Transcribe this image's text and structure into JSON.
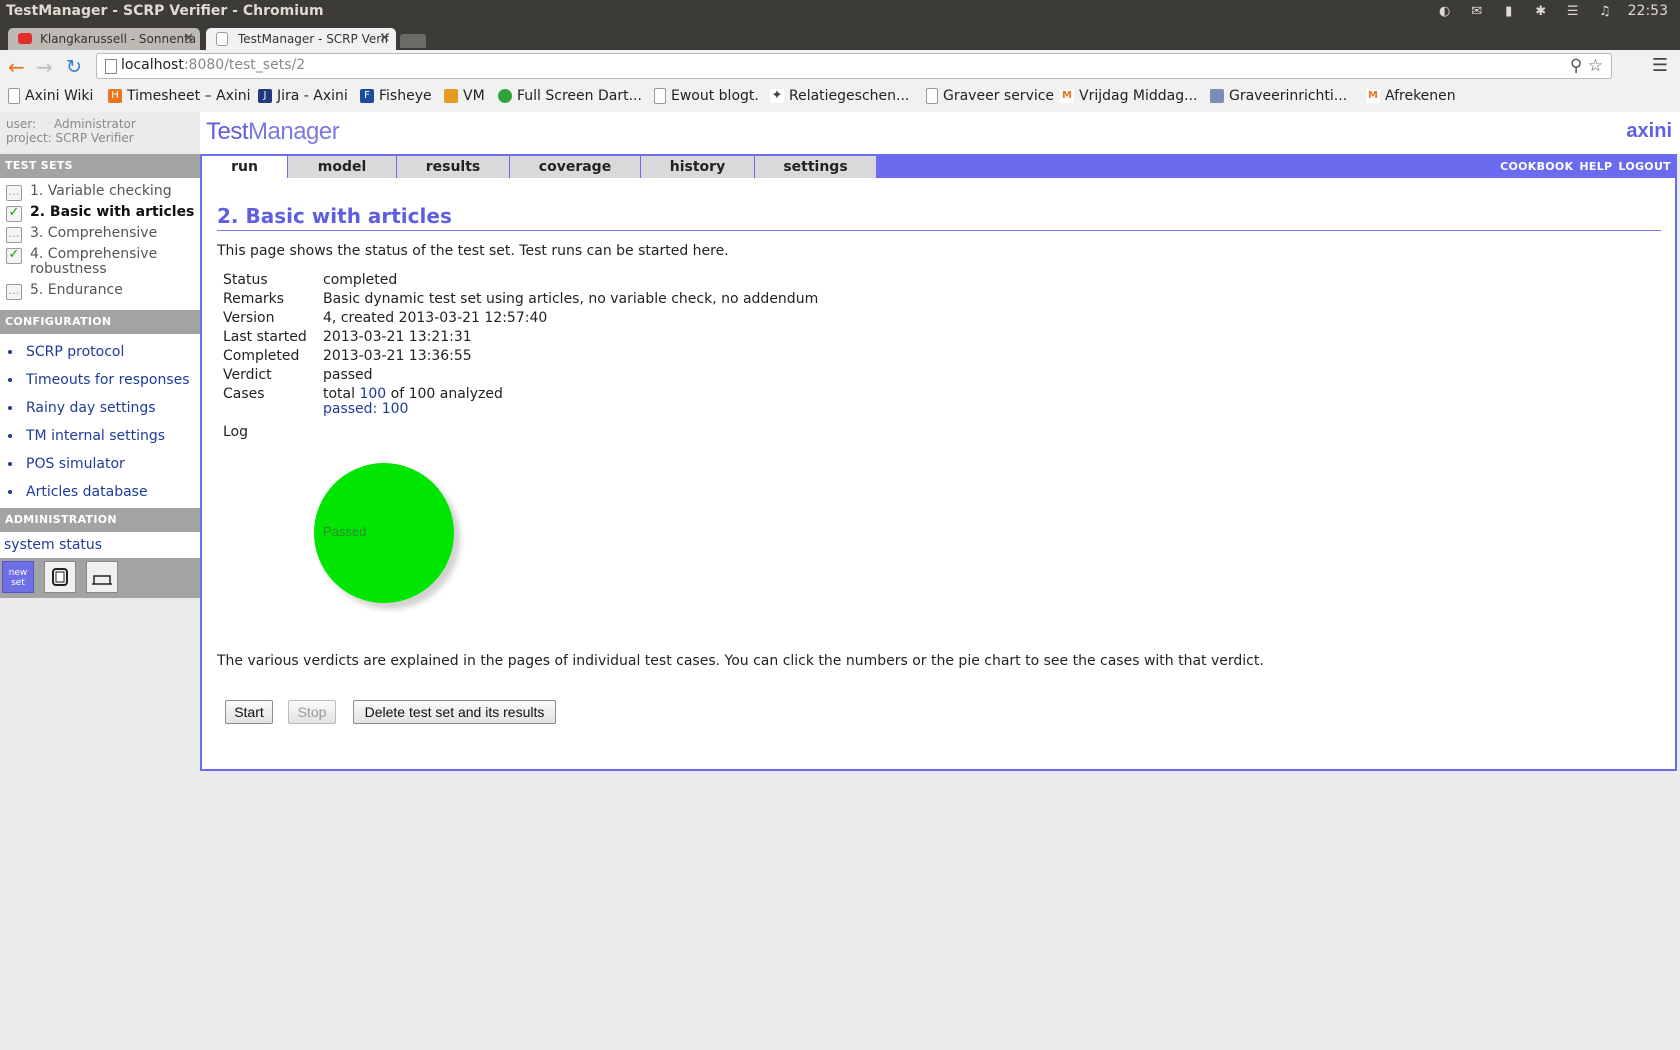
{
  "window": {
    "title": "TestManager - SCRP Verifier - Chromium",
    "clock": "22:53"
  },
  "tabs": [
    {
      "label": "Klangkarussell - Sonnenta"
    },
    {
      "label": "TestManager - SCRP Verif"
    }
  ],
  "address_bar": {
    "host": "localhost",
    "path": ":8080/test_sets/2"
  },
  "bookmarks": [
    "Axini Wiki",
    "Timesheet – Axini",
    "Jira - Axini",
    "Fisheye",
    "VM",
    "Full Screen Dart...",
    "Ewout blogt.",
    "Relatiegeschen...",
    "Graveer service",
    "Vrijdag Middag...",
    "Graveerinrichti...",
    "Afrekenen"
  ],
  "userinfo": {
    "user_label": "user:",
    "user": "Administrator",
    "project_label": "project:",
    "project": "SCRP Verifier"
  },
  "brand": {
    "logo_a": "Test",
    "logo_b": "Manager",
    "vendor": "axini",
    "accent": "#6b6bf0"
  },
  "sidebar": {
    "test_sets_heading": "TEST SETS",
    "test_sets": [
      {
        "label": "1. Variable checking",
        "checked": false
      },
      {
        "label": "2. Basic with articles",
        "checked": true
      },
      {
        "label": "3. Comprehensive",
        "checked": false
      },
      {
        "label": "4. Comprehensive robustness",
        "checked": true
      },
      {
        "label": "5. Endurance",
        "checked": false
      }
    ],
    "configuration_heading": "CONFIGURATION",
    "configuration": [
      "SCRP protocol",
      "Timeouts for responses",
      "Rainy day settings",
      "TM internal settings",
      "POS simulator",
      "Articles database"
    ],
    "administration_heading": "ADMINISTRATION",
    "system_status": "system status",
    "new_set_label": "new set"
  },
  "nav": {
    "tabs": [
      "run",
      "model",
      "results",
      "coverage",
      "history",
      "settings"
    ],
    "active": "run",
    "links": [
      "COOKBOOK",
      "HELP",
      "LOGOUT"
    ]
  },
  "main": {
    "heading": "2. Basic with articles",
    "intro": "This page shows the status of the test set. Test runs can be started here.",
    "labels": {
      "status": "Status",
      "remarks": "Remarks",
      "version": "Version",
      "last_started": "Last started",
      "completed": "Completed",
      "verdict": "Verdict",
      "cases": "Cases",
      "log": "Log"
    },
    "values": {
      "status": "completed",
      "remarks": "Basic dynamic test set using articles, no variable check, no addendum",
      "version": "4, created 2013-03-21 12:57:40",
      "last_started": "2013-03-21 13:21:31",
      "completed": "2013-03-21 13:36:55",
      "verdict": "passed",
      "cases_prefix": "total ",
      "cases_total": "100",
      "cases_suffix": " of 100 analyzed",
      "cases_passed": "passed: 100"
    },
    "verdict_note": "The various verdicts are explained in the pages of individual test cases. You can click the numbers or the pie chart to see the cases with that verdict.",
    "buttons": {
      "start": "Start",
      "stop": "Stop",
      "delete": "Delete test set and its results"
    }
  },
  "chart_data": {
    "type": "pie",
    "slices": [
      {
        "label": "Passed",
        "value": 100,
        "color": "#00e600"
      }
    ]
  }
}
